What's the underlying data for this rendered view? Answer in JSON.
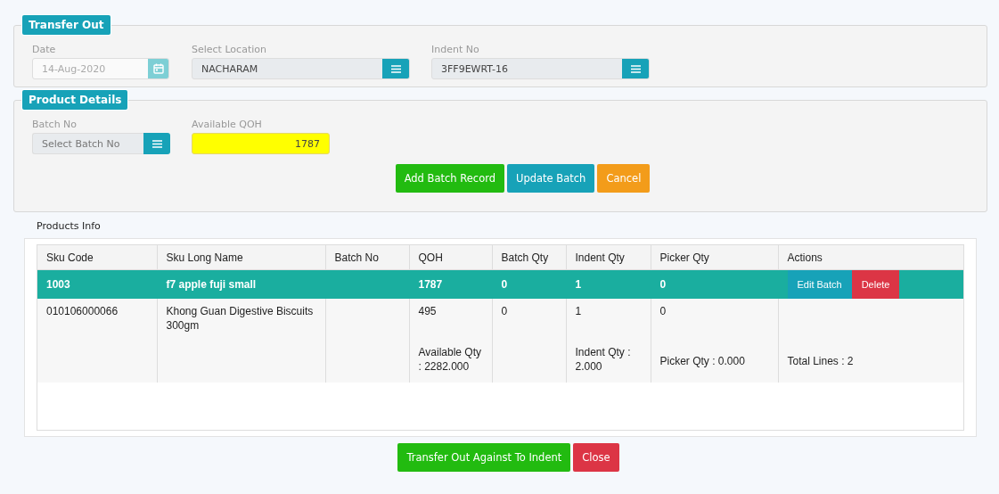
{
  "transfer_out": {
    "legend": "Transfer Out",
    "date": {
      "label": "Date",
      "value": "14-Aug-2020",
      "disabled": true
    },
    "location": {
      "label": "Select Location",
      "value": "NACHARAM"
    },
    "indent": {
      "label": "Indent No",
      "value": "3FF9EWRT-16"
    }
  },
  "product_details": {
    "legend": "Product Details",
    "batch": {
      "label": "Batch No",
      "placeholder": "Select Batch No"
    },
    "qoh": {
      "label": "Available QOH",
      "value": "1787"
    },
    "buttons": [
      {
        "label": "Add Batch Record",
        "kind": "success"
      },
      {
        "label": "Update Batch",
        "kind": "info"
      },
      {
        "label": "Cancel",
        "kind": "warning"
      }
    ]
  },
  "products_info": {
    "title": "Products Info",
    "columns": [
      "Sku Code",
      "Sku Long Name",
      "Batch No",
      "QOH",
      "Batch Qty",
      "Indent Qty",
      "Picker Qty",
      "Actions"
    ],
    "rows": [
      {
        "selected": true,
        "cells": [
          "1003",
          "f7 apple fuji small",
          null,
          "1787",
          "0",
          "1",
          "0"
        ],
        "actions": [
          {
            "label": "Edit Batch",
            "kind": "info"
          },
          {
            "label": "Delete",
            "kind": "danger"
          }
        ]
      },
      {
        "selected": false,
        "cells": [
          "010106000066",
          "Khong Guan Digestive Biscuits 300gm",
          null,
          "495",
          "0",
          "1",
          "0"
        ]
      }
    ],
    "summary": {
      "qoh": "Available Qty : 2282.000",
      "indent_qty": "Indent Qty : 2.000",
      "picker_qty": "Picker Qty : 0.000",
      "actions": "Total Lines : 2"
    }
  },
  "buttons": [
    {
      "label": "Transfer Out Against To Indent",
      "kind": "success"
    },
    {
      "label": "Close",
      "kind": "danger"
    }
  ]
}
